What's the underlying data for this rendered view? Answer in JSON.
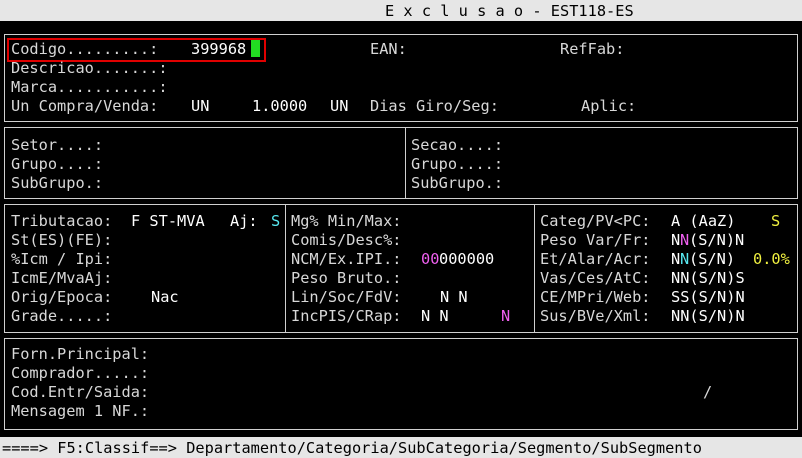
{
  "title_bar": {
    "text": "E x c l u s a o - EST118-ES"
  },
  "header": {
    "codigo_label": "Codigo.........:",
    "codigo_value": "399968",
    "ean_label": "EAN:",
    "reffab_label": "RefFab:",
    "descricao_label": "Descricao.......:",
    "marca_label": "Marca...........:",
    "un_compra_label": "Un Compra/Venda:",
    "un_compra_value": "UN",
    "fator_value": "1.0000",
    "un_venda_value": "UN",
    "dias_giro_label": "Dias Giro/Seg:",
    "aplic_label": "Aplic:"
  },
  "section_classif": {
    "setor_label": "Setor....:",
    "grupo_label": "Grupo....:",
    "subgrupo_label": "SubGrupo.:",
    "secao_label": "Secao....:",
    "grupo2_label": "Grupo....:",
    "subgrupo2_label": "SubGrupo.:"
  },
  "section_fiscal": {
    "tributacao_label": "Tributacao:",
    "tributacao_value": "F ST-MVA",
    "aj_label": "Aj:",
    "aj_value": "S",
    "st_label": "St(ES)(FE):",
    "icm_ipi_label": "%Icm / Ipi:",
    "icme_label": "IcmE/MvaAj:",
    "orig_label": "Orig/Epoca:",
    "orig_value": "Nac",
    "grade_label": "Grade.....:",
    "mg_label": "Mg% Min/Max:",
    "comis_label": "Comis/Desc%:",
    "ncm_label": "NCM/Ex.IPI.:",
    "ncm_value_a": "00",
    "ncm_value_b": "000000",
    "peso_bruto_label": "Peso Bruto.:",
    "lin_label": "Lin/Soc/FdV:",
    "lin_value": "N N",
    "incpis_label": "IncPIS/CRap:",
    "incpis_value": "N N",
    "incpis_flag": "N",
    "categ_label": "Categ/PV<PC:",
    "categ_value": "A (AaZ)",
    "categ_flag": "S",
    "peso_var_label": "Peso Var/Fr:",
    "peso_var_a": "N",
    "peso_var_b": "N",
    "peso_var_c": "(S/N)N",
    "et_label": "Et/Alar/Acr:",
    "et_a": "N",
    "et_b": "N",
    "et_c": "(S/N)",
    "et_pct": "0.0%",
    "vas_label": "Vas/Ces/AtC:",
    "vas_value": "NN(S/N)S",
    "ce_label": "CE/MPri/Web:",
    "ce_value": "SS(S/N)N",
    "sus_label": "Sus/BVe/Xml:",
    "sus_value": "NN(S/N)N"
  },
  "section_fornecedor": {
    "forn_label": "Forn.Principal:",
    "comprador_label": "Comprador.....:",
    "cod_entr_label": "Cod.Entr/Saida:",
    "cod_entr_sep": "/",
    "mensagem_label": "Mensagem 1 NF.:"
  },
  "status_bar": {
    "text": "====> F5:Classif==> Departamento/Categoria/SubCategoria/Segmento/SubSegmento"
  },
  "colors": {
    "highlight_box": "#e00000",
    "cursor": "#22dd22",
    "cyan": "#58e8f0",
    "magenta": "#f060f0",
    "yellow": "#f0f040"
  }
}
